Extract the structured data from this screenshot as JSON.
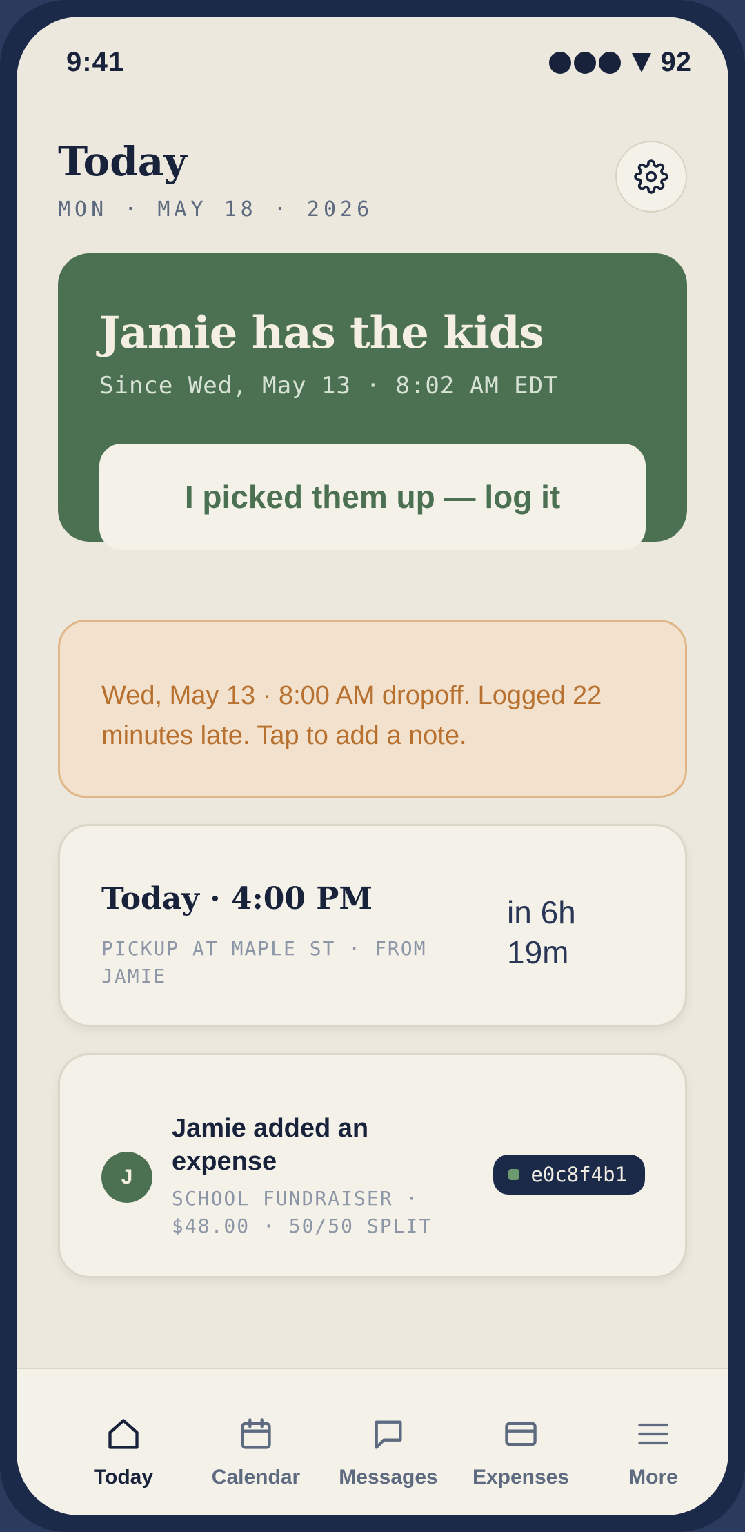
{
  "status_bar": {
    "time": "9:41",
    "battery": "92"
  },
  "header": {
    "title": "Today",
    "date": "MON · MAY 18 · 2026"
  },
  "custody": {
    "title": "Jamie has the kids",
    "since": "Since Wed, May 13 · 8:02 AM EDT",
    "action_label": "I picked them up — log it",
    "color": "#4b7152"
  },
  "alert": {
    "text": "Wed, May 13 · 8:00 AM dropoff. Logged 22 minutes late. Tap to add a note.",
    "color": "#b8702f"
  },
  "next_event": {
    "title": "Today · 4:00 PM",
    "subtitle": "PICKUP AT MAPLE ST · FROM JAMIE",
    "eta": "in 6h 19m"
  },
  "activity": {
    "avatar_initial": "J",
    "title": "Jamie added an expense",
    "subtitle": "SCHOOL FUNDRAISER · $48.00 · 50/50 SPLIT",
    "hash": "e0c8f4b1"
  },
  "tabs": [
    {
      "label": "Today",
      "icon": "home-icon",
      "active": true
    },
    {
      "label": "Calendar",
      "icon": "calendar-icon",
      "active": false
    },
    {
      "label": "Messages",
      "icon": "message-icon",
      "active": false
    },
    {
      "label": "Expenses",
      "icon": "card-icon",
      "active": false
    },
    {
      "label": "More",
      "icon": "menu-icon",
      "active": false
    }
  ]
}
